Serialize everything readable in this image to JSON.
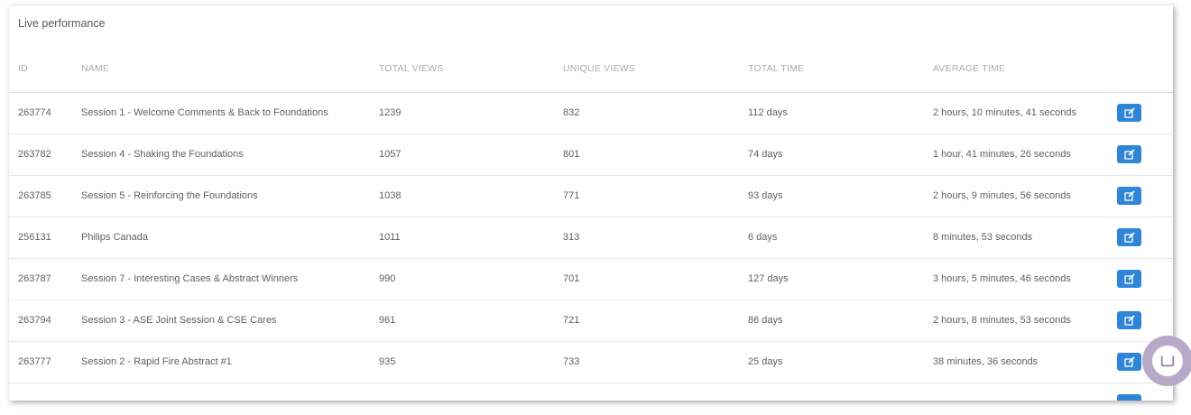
{
  "panel": {
    "title": "Live performance"
  },
  "table": {
    "columns": [
      "ID",
      "NAME",
      "TOTAL VIEWS",
      "UNIQUE VIEWS",
      "TOTAL TIME",
      "AVERAGE TIME"
    ],
    "rows": [
      {
        "id": "263774",
        "name": "Session 1 - Welcome Comments & Back to Foundations",
        "total_views": "1239",
        "unique_views": "832",
        "total_time": "112 days",
        "average_time": "2 hours, 10 minutes, 41 seconds"
      },
      {
        "id": "263782",
        "name": "Session 4 - Shaking the Foundations",
        "total_views": "1057",
        "unique_views": "801",
        "total_time": "74 days",
        "average_time": "1 hour, 41 minutes, 26 seconds"
      },
      {
        "id": "263785",
        "name": "Session 5 - Reinforcing the Foundations",
        "total_views": "1038",
        "unique_views": "771",
        "total_time": "93 days",
        "average_time": "2 hours, 9 minutes, 56 seconds"
      },
      {
        "id": "256131",
        "name": "Philips Canada",
        "total_views": "1011",
        "unique_views": "313",
        "total_time": "6 days",
        "average_time": "8 minutes, 53 seconds"
      },
      {
        "id": "263787",
        "name": "Session 7 - Interesting Cases & Abstract Winners",
        "total_views": "990",
        "unique_views": "701",
        "total_time": "127 days",
        "average_time": "3 hours, 5 minutes, 46 seconds"
      },
      {
        "id": "263794",
        "name": "Session 3 - ASE Joint Session & CSE Cares",
        "total_views": "961",
        "unique_views": "721",
        "total_time": "86 days",
        "average_time": "2 hours, 8 minutes, 53 seconds"
      },
      {
        "id": "263777",
        "name": "Session 2 - Rapid Fire Abstract #1",
        "total_views": "935",
        "unique_views": "733",
        "total_time": "25 days",
        "average_time": "38 minutes, 36 seconds"
      }
    ],
    "row_action_icon": "edit-icon"
  },
  "colors": {
    "accent": "#2f86d9",
    "chat_bubble": "#b9a9c9"
  },
  "chat": {
    "icon": "chat-icon"
  }
}
